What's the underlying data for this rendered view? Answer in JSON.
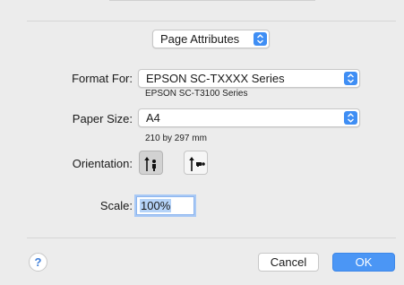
{
  "settings_popup": {
    "value": "Page Attributes"
  },
  "format_for": {
    "label": "Format For:",
    "value": "EPSON SC-TXXXX Series",
    "detail": "EPSON SC-T3100 Series"
  },
  "paper_size": {
    "label": "Paper Size:",
    "value": "A4",
    "detail": "210 by 297 mm"
  },
  "orientation": {
    "label": "Orientation:",
    "options": [
      {
        "icon": "portrait-orientation-icon",
        "selected": true
      },
      {
        "icon": "landscape-orientation-icon",
        "selected": false
      }
    ]
  },
  "scale": {
    "label": "Scale:",
    "value": "100%"
  },
  "help": {
    "label": "?"
  },
  "buttons": {
    "cancel": "Cancel",
    "ok": "OK"
  },
  "colors": {
    "accent": "#3f8ef4",
    "ok_button": "#4b96f5",
    "window_bg": "#ececec"
  }
}
